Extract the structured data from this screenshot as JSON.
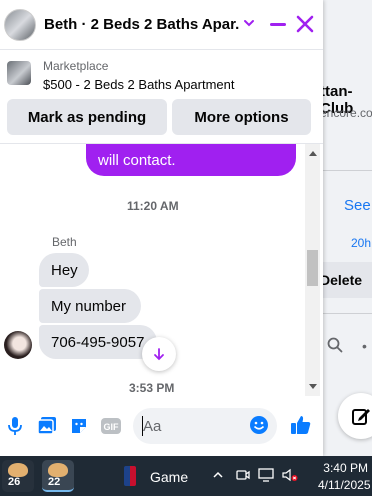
{
  "background": {
    "title": "ttan-Club",
    "subtitle": "encore.com",
    "see_link": "See",
    "time_link": "20h",
    "delete_label": "Delete"
  },
  "chat": {
    "title": "Beth · 2 Beds 2 Baths Apar...",
    "marketplace_label": "Marketplace",
    "item_title": "$500 - 2 Beds 2 Baths Apartment",
    "mark_pending_label": "Mark as pending",
    "more_options_label": "More options",
    "outgoing_text": "will contact.",
    "timestamp1": "11:20 AM",
    "sender_name": "Beth",
    "messages": [
      "Hey",
      "My number",
      "706-495-9057"
    ],
    "timestamp2": "3:53 PM",
    "input_placeholder": "Aa",
    "accent_color": "#a020f0",
    "icon_color": "#0a7cff"
  },
  "taskbar": {
    "app1_badge": "26",
    "app2_badge": "22",
    "game_label": "Game",
    "time": "3:40 PM",
    "date": "4/11/2025"
  }
}
